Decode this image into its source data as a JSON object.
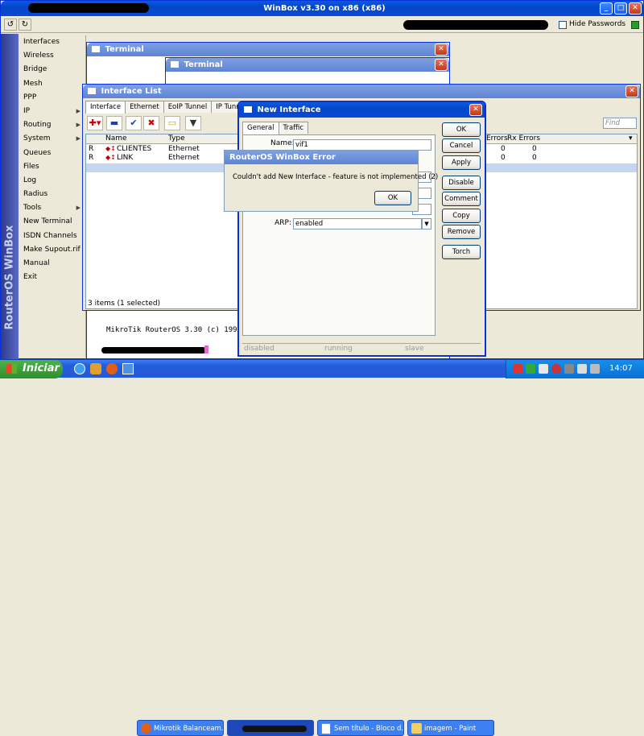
{
  "main_window": {
    "title": "WinBox v3.30 on x86 (x86)",
    "hide_passwords_label": "Hide Passwords"
  },
  "sidebar": {
    "vertical_label": "RouterOS WinBox",
    "items": [
      {
        "label": "Interfaces",
        "submenu": false
      },
      {
        "label": "Wireless",
        "submenu": false
      },
      {
        "label": "Bridge",
        "submenu": false
      },
      {
        "label": "Mesh",
        "submenu": false
      },
      {
        "label": "PPP",
        "submenu": false
      },
      {
        "label": "IP",
        "submenu": true
      },
      {
        "label": "Routing",
        "submenu": true
      },
      {
        "label": "System",
        "submenu": true
      },
      {
        "label": "Queues",
        "submenu": false
      },
      {
        "label": "Files",
        "submenu": false
      },
      {
        "label": "Log",
        "submenu": false
      },
      {
        "label": "Radius",
        "submenu": false
      },
      {
        "label": "Tools",
        "submenu": true
      },
      {
        "label": "New Terminal",
        "submenu": false
      },
      {
        "label": "ISDN Channels",
        "submenu": false
      },
      {
        "label": "Make Supout.rif",
        "submenu": false
      },
      {
        "label": "Manual",
        "submenu": false
      },
      {
        "label": "Exit",
        "submenu": false
      }
    ]
  },
  "terminal1": {
    "title": "Terminal",
    "text_line": "MikroTik RouterOS 3.30 (c) 199"
  },
  "terminal2": {
    "title": "Terminal"
  },
  "interface_list": {
    "title": "Interface List",
    "tabs": [
      "Interface",
      "Ethernet",
      "EoIP Tunnel",
      "IP Tunnel"
    ],
    "find_placeholder": "Find",
    "columns": {
      "name": "Name",
      "type": "Type",
      "tx_errors": "Errors",
      "rx_errors": "Rx Errors"
    },
    "rows": [
      {
        "flag": "R",
        "name": "CLIENTES",
        "type": "Ethernet",
        "tx": "0",
        "rx": "0"
      },
      {
        "flag": "R",
        "name": "LINK",
        "type": "Ethernet",
        "tx": "0",
        "rx": "0"
      }
    ],
    "status": "3 items (1 selected)"
  },
  "new_interface": {
    "title": "New Interface",
    "tabs": [
      "General",
      "Traffic"
    ],
    "name_label": "Name:",
    "name_value": "vif1",
    "arp_label": "ARP:",
    "arp_value": "enabled",
    "buttons": [
      "OK",
      "Cancel",
      "Apply",
      "Disable",
      "Comment",
      "Copy",
      "Remove",
      "Torch"
    ],
    "status": [
      "disabled",
      "running",
      "slave"
    ]
  },
  "error_dialog": {
    "title": "RouterOS WinBox Error",
    "message": "Couldn't add New Interface - feature is not implemented (2)",
    "ok_label": "OK"
  },
  "taskbar": {
    "start_label": "Iniciar",
    "tasks": [
      "Mikrotik Balanceam...",
      "Sem título - Bloco d...",
      "imagem - Paint"
    ],
    "clock": "14:07"
  }
}
